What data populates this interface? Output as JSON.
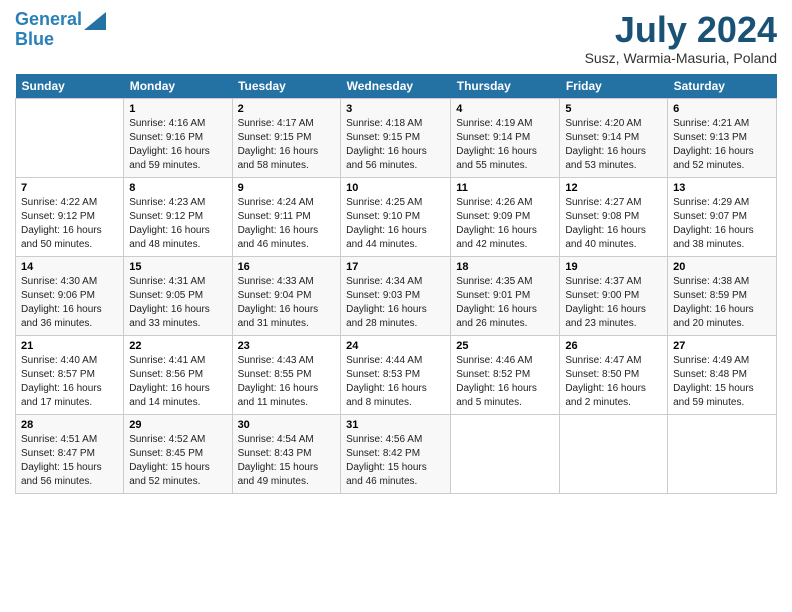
{
  "header": {
    "logo_line1": "General",
    "logo_line2": "Blue",
    "month_title": "July 2024",
    "location": "Susz, Warmia-Masuria, Poland"
  },
  "weekdays": [
    "Sunday",
    "Monday",
    "Tuesday",
    "Wednesday",
    "Thursday",
    "Friday",
    "Saturday"
  ],
  "weeks": [
    [
      {
        "day": "",
        "info": ""
      },
      {
        "day": "1",
        "info": "Sunrise: 4:16 AM\nSunset: 9:16 PM\nDaylight: 16 hours\nand 59 minutes."
      },
      {
        "day": "2",
        "info": "Sunrise: 4:17 AM\nSunset: 9:15 PM\nDaylight: 16 hours\nand 58 minutes."
      },
      {
        "day": "3",
        "info": "Sunrise: 4:18 AM\nSunset: 9:15 PM\nDaylight: 16 hours\nand 56 minutes."
      },
      {
        "day": "4",
        "info": "Sunrise: 4:19 AM\nSunset: 9:14 PM\nDaylight: 16 hours\nand 55 minutes."
      },
      {
        "day": "5",
        "info": "Sunrise: 4:20 AM\nSunset: 9:14 PM\nDaylight: 16 hours\nand 53 minutes."
      },
      {
        "day": "6",
        "info": "Sunrise: 4:21 AM\nSunset: 9:13 PM\nDaylight: 16 hours\nand 52 minutes."
      }
    ],
    [
      {
        "day": "7",
        "info": "Sunrise: 4:22 AM\nSunset: 9:12 PM\nDaylight: 16 hours\nand 50 minutes."
      },
      {
        "day": "8",
        "info": "Sunrise: 4:23 AM\nSunset: 9:12 PM\nDaylight: 16 hours\nand 48 minutes."
      },
      {
        "day": "9",
        "info": "Sunrise: 4:24 AM\nSunset: 9:11 PM\nDaylight: 16 hours\nand 46 minutes."
      },
      {
        "day": "10",
        "info": "Sunrise: 4:25 AM\nSunset: 9:10 PM\nDaylight: 16 hours\nand 44 minutes."
      },
      {
        "day": "11",
        "info": "Sunrise: 4:26 AM\nSunset: 9:09 PM\nDaylight: 16 hours\nand 42 minutes."
      },
      {
        "day": "12",
        "info": "Sunrise: 4:27 AM\nSunset: 9:08 PM\nDaylight: 16 hours\nand 40 minutes."
      },
      {
        "day": "13",
        "info": "Sunrise: 4:29 AM\nSunset: 9:07 PM\nDaylight: 16 hours\nand 38 minutes."
      }
    ],
    [
      {
        "day": "14",
        "info": "Sunrise: 4:30 AM\nSunset: 9:06 PM\nDaylight: 16 hours\nand 36 minutes."
      },
      {
        "day": "15",
        "info": "Sunrise: 4:31 AM\nSunset: 9:05 PM\nDaylight: 16 hours\nand 33 minutes."
      },
      {
        "day": "16",
        "info": "Sunrise: 4:33 AM\nSunset: 9:04 PM\nDaylight: 16 hours\nand 31 minutes."
      },
      {
        "day": "17",
        "info": "Sunrise: 4:34 AM\nSunset: 9:03 PM\nDaylight: 16 hours\nand 28 minutes."
      },
      {
        "day": "18",
        "info": "Sunrise: 4:35 AM\nSunset: 9:01 PM\nDaylight: 16 hours\nand 26 minutes."
      },
      {
        "day": "19",
        "info": "Sunrise: 4:37 AM\nSunset: 9:00 PM\nDaylight: 16 hours\nand 23 minutes."
      },
      {
        "day": "20",
        "info": "Sunrise: 4:38 AM\nSunset: 8:59 PM\nDaylight: 16 hours\nand 20 minutes."
      }
    ],
    [
      {
        "day": "21",
        "info": "Sunrise: 4:40 AM\nSunset: 8:57 PM\nDaylight: 16 hours\nand 17 minutes."
      },
      {
        "day": "22",
        "info": "Sunrise: 4:41 AM\nSunset: 8:56 PM\nDaylight: 16 hours\nand 14 minutes."
      },
      {
        "day": "23",
        "info": "Sunrise: 4:43 AM\nSunset: 8:55 PM\nDaylight: 16 hours\nand 11 minutes."
      },
      {
        "day": "24",
        "info": "Sunrise: 4:44 AM\nSunset: 8:53 PM\nDaylight: 16 hours\nand 8 minutes."
      },
      {
        "day": "25",
        "info": "Sunrise: 4:46 AM\nSunset: 8:52 PM\nDaylight: 16 hours\nand 5 minutes."
      },
      {
        "day": "26",
        "info": "Sunrise: 4:47 AM\nSunset: 8:50 PM\nDaylight: 16 hours\nand 2 minutes."
      },
      {
        "day": "27",
        "info": "Sunrise: 4:49 AM\nSunset: 8:48 PM\nDaylight: 15 hours\nand 59 minutes."
      }
    ],
    [
      {
        "day": "28",
        "info": "Sunrise: 4:51 AM\nSunset: 8:47 PM\nDaylight: 15 hours\nand 56 minutes."
      },
      {
        "day": "29",
        "info": "Sunrise: 4:52 AM\nSunset: 8:45 PM\nDaylight: 15 hours\nand 52 minutes."
      },
      {
        "day": "30",
        "info": "Sunrise: 4:54 AM\nSunset: 8:43 PM\nDaylight: 15 hours\nand 49 minutes."
      },
      {
        "day": "31",
        "info": "Sunrise: 4:56 AM\nSunset: 8:42 PM\nDaylight: 15 hours\nand 46 minutes."
      },
      {
        "day": "",
        "info": ""
      },
      {
        "day": "",
        "info": ""
      },
      {
        "day": "",
        "info": ""
      }
    ]
  ]
}
